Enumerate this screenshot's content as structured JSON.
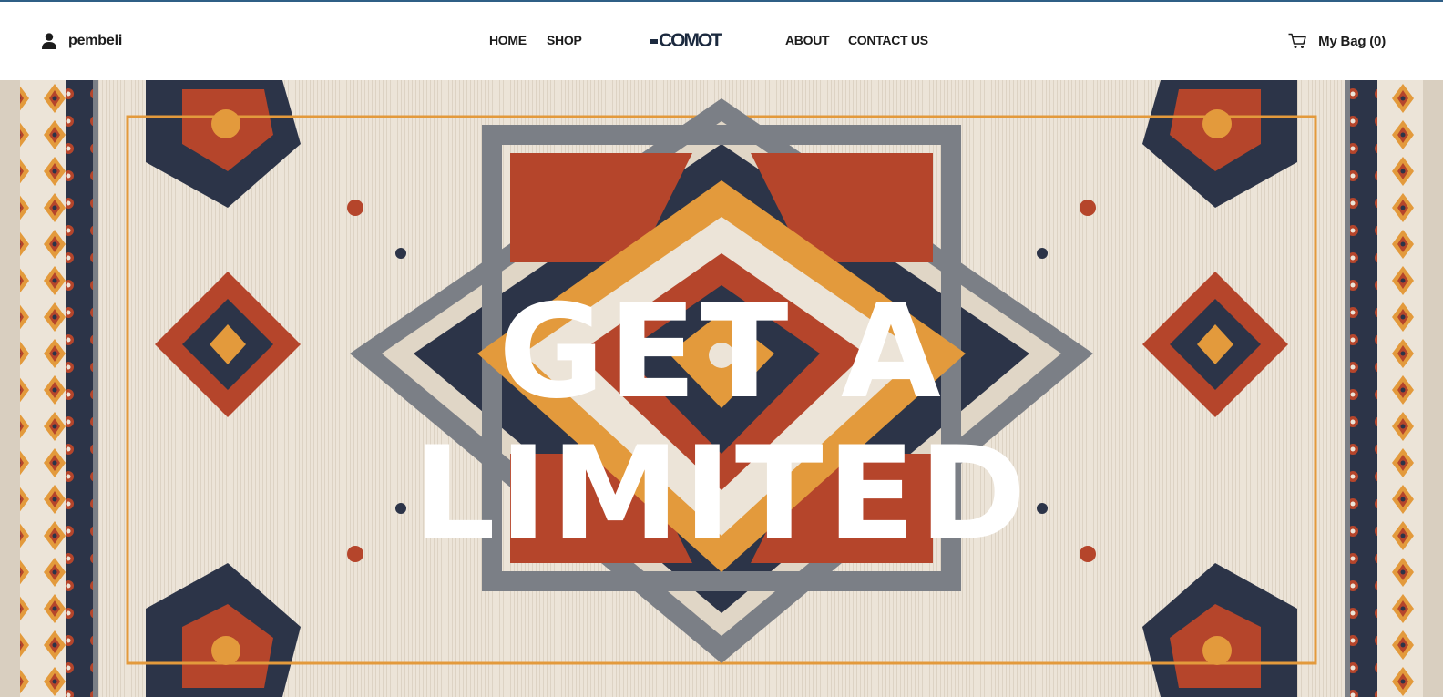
{
  "header": {
    "user": {
      "name": "pembeli",
      "icon": "user-icon"
    },
    "nav": {
      "home": "HOME",
      "shop": "SHOP",
      "about": "ABOUT",
      "contact": "CONTACT US"
    },
    "logo": {
      "text": "COMOT"
    },
    "cart": {
      "label": "My Bag (0)",
      "icon": "cart-icon"
    }
  },
  "hero": {
    "line1": "GET A",
    "line2": "LIMITED"
  },
  "colors": {
    "accent_top_line": "#2f5f86",
    "text": "#1c1c1c",
    "hero_text": "#ffffff",
    "rug_cream": "#ece4d8",
    "rug_navy": "#2c3448",
    "rug_rust": "#b5452b",
    "rug_orange": "#e39a3c",
    "rug_grey": "#7b7f86"
  }
}
